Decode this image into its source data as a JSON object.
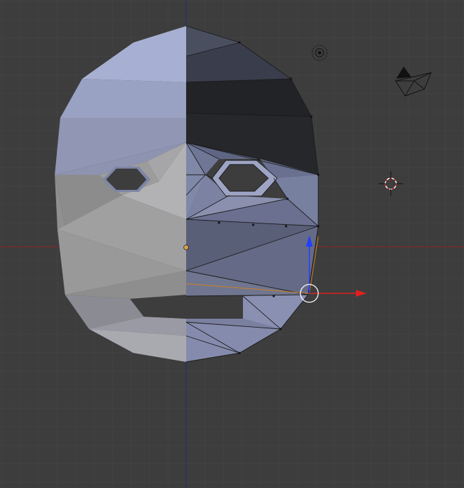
{
  "app": {
    "name": "3D viewport"
  },
  "viewport": {
    "view": "front-orthographic",
    "background_color": "#3d3d3d",
    "grid_color": "#444444",
    "axis_x_color": "#8a2a2a",
    "axis_z_color": "#1f2a8a"
  },
  "mesh": {
    "name": "face-mesh",
    "mode": "edit",
    "mirror": "x-axis",
    "left_shading": "smooth-grey-blue",
    "right_shading": "flat-wire"
  },
  "gizmo": {
    "type": "translate",
    "x_color": "#e02020",
    "z_color": "#2040ff",
    "center_color": "#ffffff"
  },
  "scene_objects": [
    {
      "name": "light-icon"
    },
    {
      "name": "camera-icon"
    },
    {
      "name": "3d-cursor-icon"
    }
  ]
}
